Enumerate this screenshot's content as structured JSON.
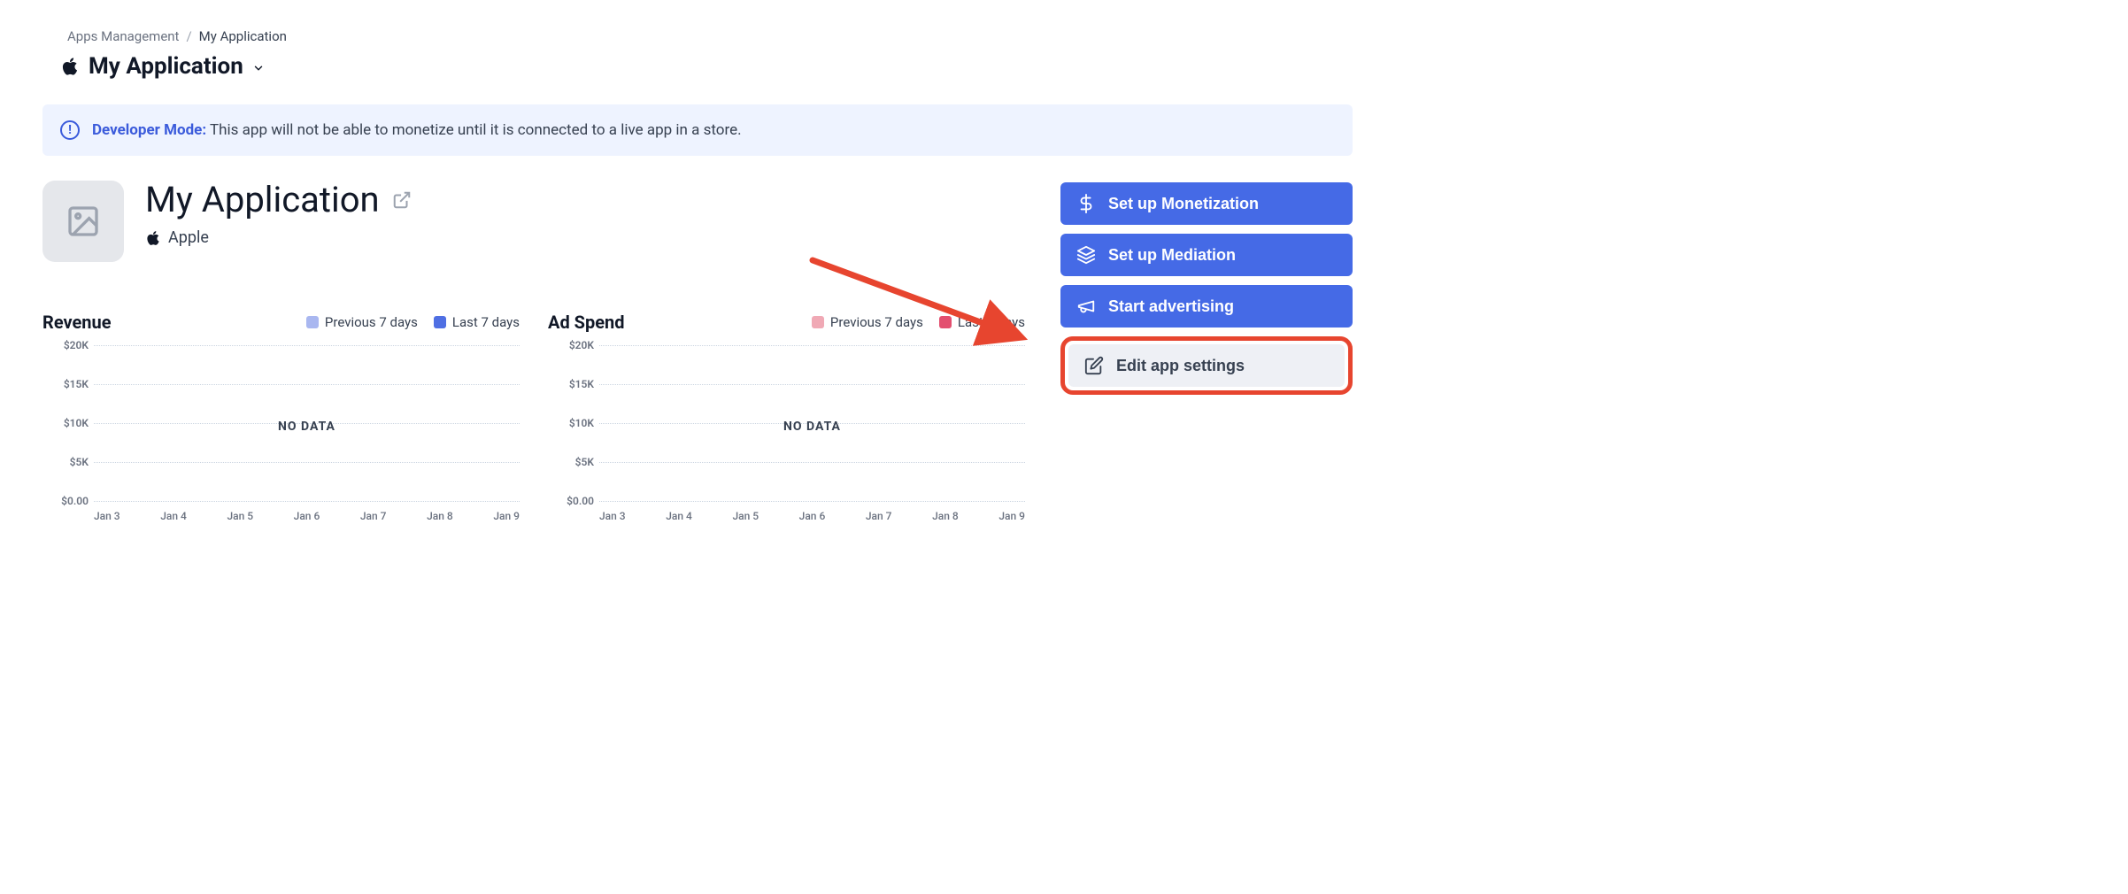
{
  "breadcrumb": {
    "parent": "Apps Management",
    "current": "My Application"
  },
  "app_selector": {
    "name": "My Application"
  },
  "notice": {
    "label": "Developer Mode:",
    "text": "This app will not be able to monetize until it is connected to a live app in a store."
  },
  "app": {
    "name": "My Application",
    "platform": "Apple"
  },
  "actions": {
    "monetization": "Set up Monetization",
    "mediation": "Set up Mediation",
    "advertising": "Start advertising",
    "edit_settings": "Edit app settings"
  },
  "charts": {
    "revenue": {
      "title": "Revenue",
      "legend_prev": "Previous 7 days",
      "legend_last": "Last 7 days",
      "prev_color": "#a9b7f0",
      "last_color": "#4f6fe3",
      "no_data": "NO DATA"
    },
    "adspend": {
      "title": "Ad Spend",
      "legend_prev": "Previous 7 days",
      "legend_last": "Last 7 days",
      "prev_color": "#f0a9b5",
      "last_color": "#e34f6f",
      "no_data": "NO DATA"
    },
    "y_ticks": [
      "$20K",
      "$15K",
      "$10K",
      "$5K",
      "$0.00"
    ],
    "x_ticks": [
      "Jan 3",
      "Jan 4",
      "Jan 5",
      "Jan 6",
      "Jan 7",
      "Jan 8",
      "Jan 9"
    ]
  },
  "chart_data": [
    {
      "type": "line",
      "title": "Revenue",
      "xlabel": "",
      "ylabel": "",
      "ylim": [
        0,
        20000
      ],
      "categories": [
        "Jan 3",
        "Jan 4",
        "Jan 5",
        "Jan 6",
        "Jan 7",
        "Jan 8",
        "Jan 9"
      ],
      "series": [
        {
          "name": "Previous 7 days",
          "values": [
            null,
            null,
            null,
            null,
            null,
            null,
            null
          ]
        },
        {
          "name": "Last 7 days",
          "values": [
            null,
            null,
            null,
            null,
            null,
            null,
            null
          ]
        }
      ],
      "note": "NO DATA"
    },
    {
      "type": "line",
      "title": "Ad Spend",
      "xlabel": "",
      "ylabel": "",
      "ylim": [
        0,
        20000
      ],
      "categories": [
        "Jan 3",
        "Jan 4",
        "Jan 5",
        "Jan 6",
        "Jan 7",
        "Jan 8",
        "Jan 9"
      ],
      "series": [
        {
          "name": "Previous 7 days",
          "values": [
            null,
            null,
            null,
            null,
            null,
            null,
            null
          ]
        },
        {
          "name": "Last 7 days",
          "values": [
            null,
            null,
            null,
            null,
            null,
            null,
            null
          ]
        }
      ],
      "note": "NO DATA"
    }
  ]
}
